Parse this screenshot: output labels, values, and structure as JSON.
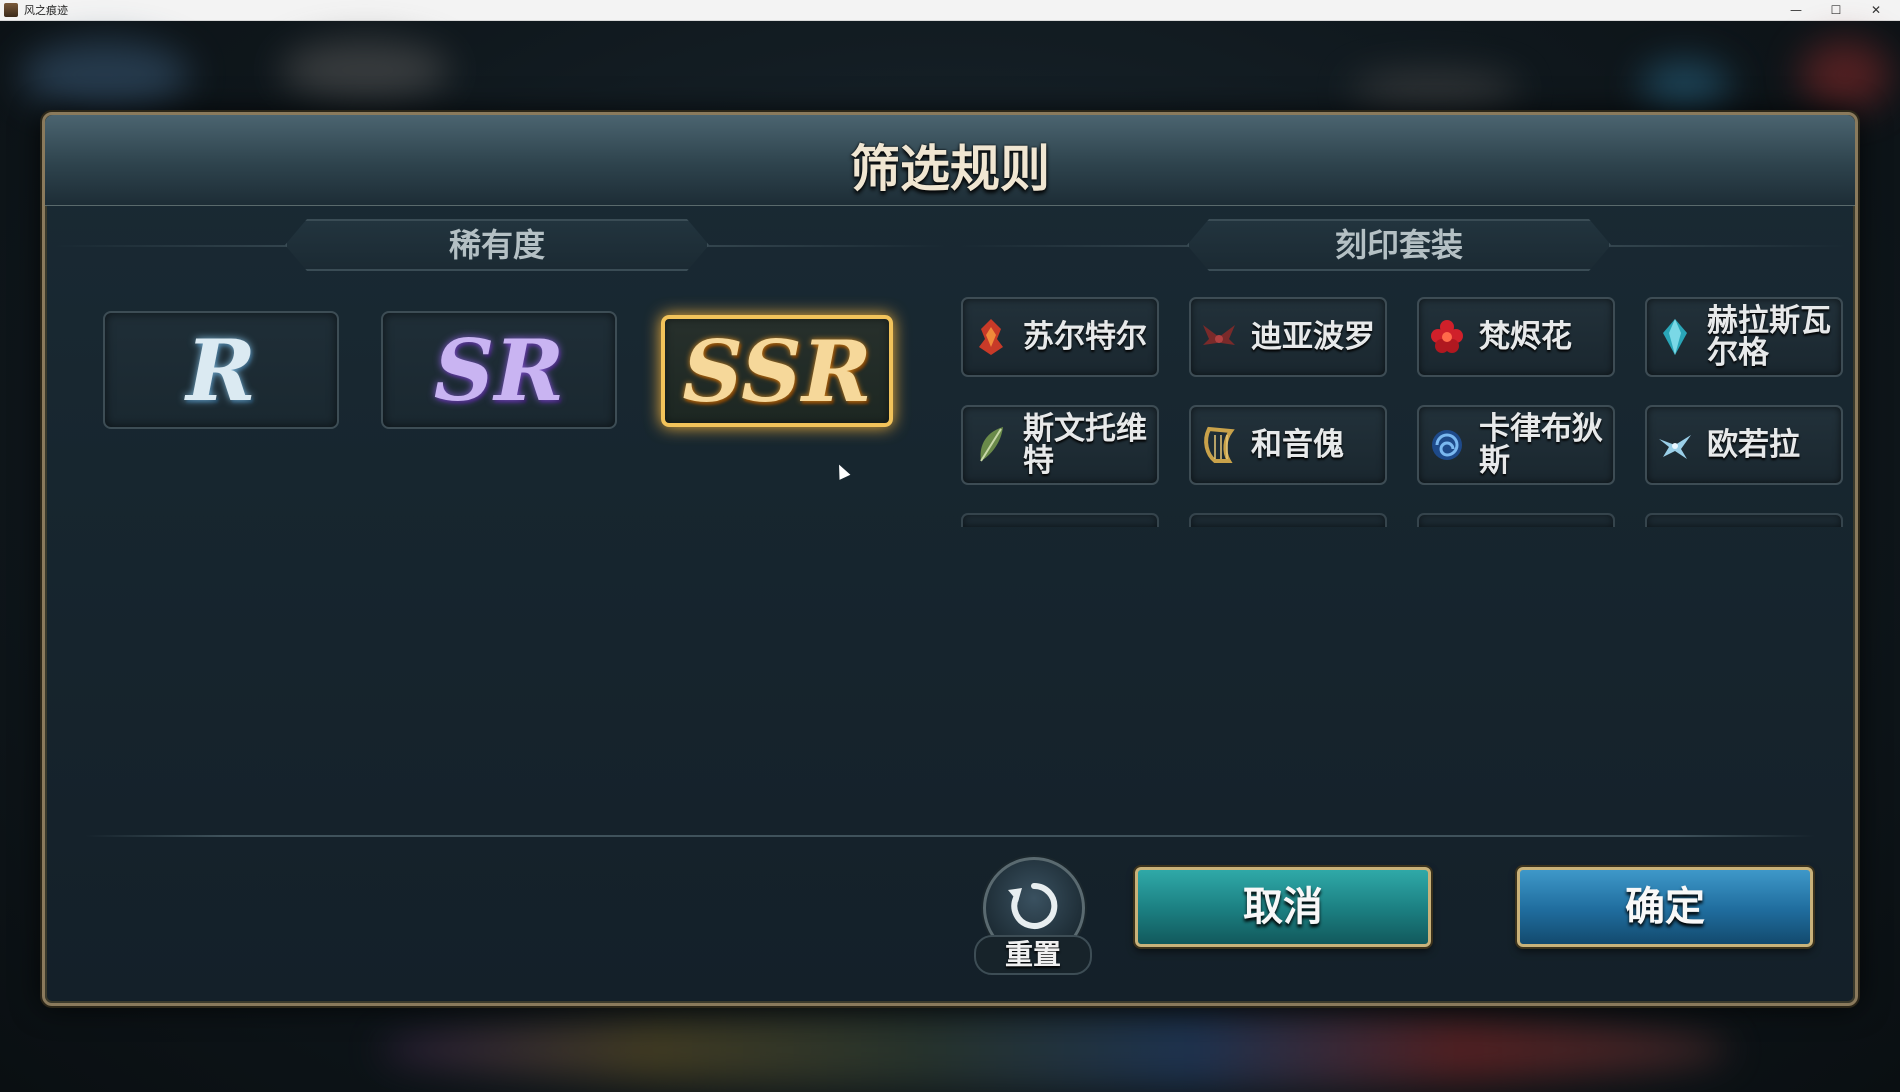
{
  "window": {
    "title": "风之痕迹",
    "minimize": "—",
    "maximize": "☐",
    "close": "✕"
  },
  "dialog": {
    "title": "筛选规则",
    "rarity_section": {
      "heading": "稀有度",
      "options": [
        {
          "label": "R",
          "selected": false
        },
        {
          "label": "SR",
          "selected": false
        },
        {
          "label": "SSR",
          "selected": true
        }
      ]
    },
    "imprint_section": {
      "heading": "刻印套装",
      "sets": [
        {
          "label": "苏尔特尔",
          "icon": "red-flame-crest-icon",
          "color": "#c83a28"
        },
        {
          "label": "迪亚波罗",
          "icon": "demon-wings-icon",
          "color": "#7a2a2a"
        },
        {
          "label": "梵烬花",
          "icon": "red-flower-icon",
          "color": "#d0202a"
        },
        {
          "label": "赫拉斯瓦尔格",
          "icon": "cyan-crystal-icon",
          "color": "#2aa6b8"
        },
        {
          "label": "斯文托维特",
          "icon": "green-feather-icon",
          "color": "#6a8a4a"
        },
        {
          "label": "和音傀",
          "icon": "golden-harp-icon",
          "color": "#c9a24a"
        },
        {
          "label": "卡律布狄斯",
          "icon": "blue-whirlpool-icon",
          "color": "#3a7ad0"
        },
        {
          "label": "欧若拉",
          "icon": "ice-bird-icon",
          "color": "#9acfe8"
        }
      ]
    },
    "footer": {
      "reset_label": "重置",
      "cancel_label": "取消",
      "confirm_label": "确定"
    }
  },
  "colors": {
    "selected_gold": "#f2c35a",
    "cancel_teal": "#1b7e80",
    "confirm_blue": "#1f6c9d"
  }
}
